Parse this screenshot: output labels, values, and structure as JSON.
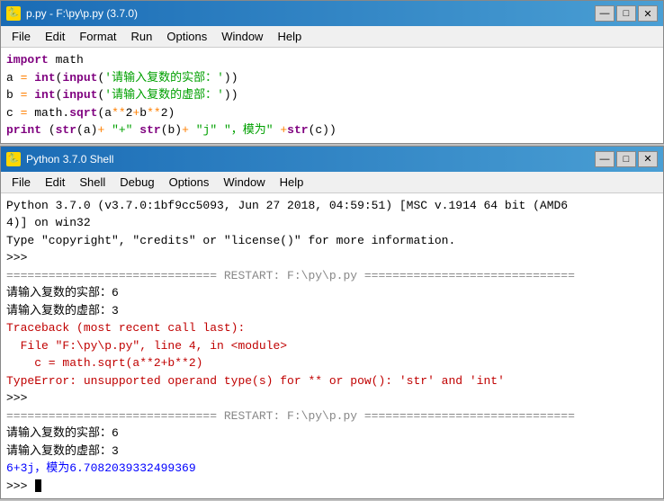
{
  "editor_window": {
    "title": "p.py - F:\\py\\p.py (3.7.0)",
    "icon": "🐍",
    "menu": [
      "File",
      "Edit",
      "Format",
      "Run",
      "Options",
      "Window",
      "Help"
    ],
    "code_lines": [
      {
        "text": "import math",
        "type": "code"
      },
      {
        "text": "a = int(input('请输入复数的实部：'))",
        "type": "code"
      },
      {
        "text": "b = int(input('请输入复数的虚部：'))",
        "type": "code"
      },
      {
        "text": "c = math.sqrt(a**2+b**2)",
        "type": "code"
      },
      {
        "text": "print (str(a)+ \"+\" str(b)+ \"j\" \"，模为\" +str(c))",
        "type": "code"
      }
    ]
  },
  "shell_window": {
    "title": "Python 3.7.0 Shell",
    "icon": "🐍",
    "menu": [
      "File",
      "Edit",
      "Shell",
      "Debug",
      "Options",
      "Window",
      "Help"
    ],
    "lines": [
      {
        "text": "Python 3.7.0 (v3.7.0:1bf9cc5093, Jun 27 2018, 04:59:51) [MSC v.1914 64 bit (AMD6",
        "type": "normal"
      },
      {
        "text": "4)] on win32",
        "type": "normal"
      },
      {
        "text": "Type \"copyright\", \"credits\" or \"license()\" for more information.",
        "type": "normal"
      },
      {
        "text": ">>> ",
        "type": "prompt"
      },
      {
        "text": "============================== RESTART: F:\\py\\p.py ==============================",
        "type": "divider"
      },
      {
        "text": "请输入复数的实部：6",
        "type": "normal"
      },
      {
        "text": "请输入复数的虚部：3",
        "type": "normal"
      },
      {
        "text": "Traceback (most recent call last):",
        "type": "red"
      },
      {
        "text": "  File \"F:\\py\\p.py\", line 4, in <module>",
        "type": "red"
      },
      {
        "text": "    c = math.sqrt(a**2+b**2)",
        "type": "red"
      },
      {
        "text": "TypeError: unsupported operand type(s) for ** or pow(): 'str' and 'int'",
        "type": "red"
      },
      {
        "text": ">>> ",
        "type": "prompt"
      },
      {
        "text": "============================== RESTART: F:\\py\\p.py ==============================",
        "type": "divider"
      },
      {
        "text": "请输入复数的实部：6",
        "type": "normal"
      },
      {
        "text": "请输入复数的虚部：3",
        "type": "normal"
      },
      {
        "text": "6+3j，模为6.7082039332499369",
        "type": "blue"
      },
      {
        "text": ">>> ",
        "type": "prompt_cursor"
      }
    ]
  },
  "controls": {
    "minimize": "—",
    "maximize": "□",
    "close": "✕"
  }
}
